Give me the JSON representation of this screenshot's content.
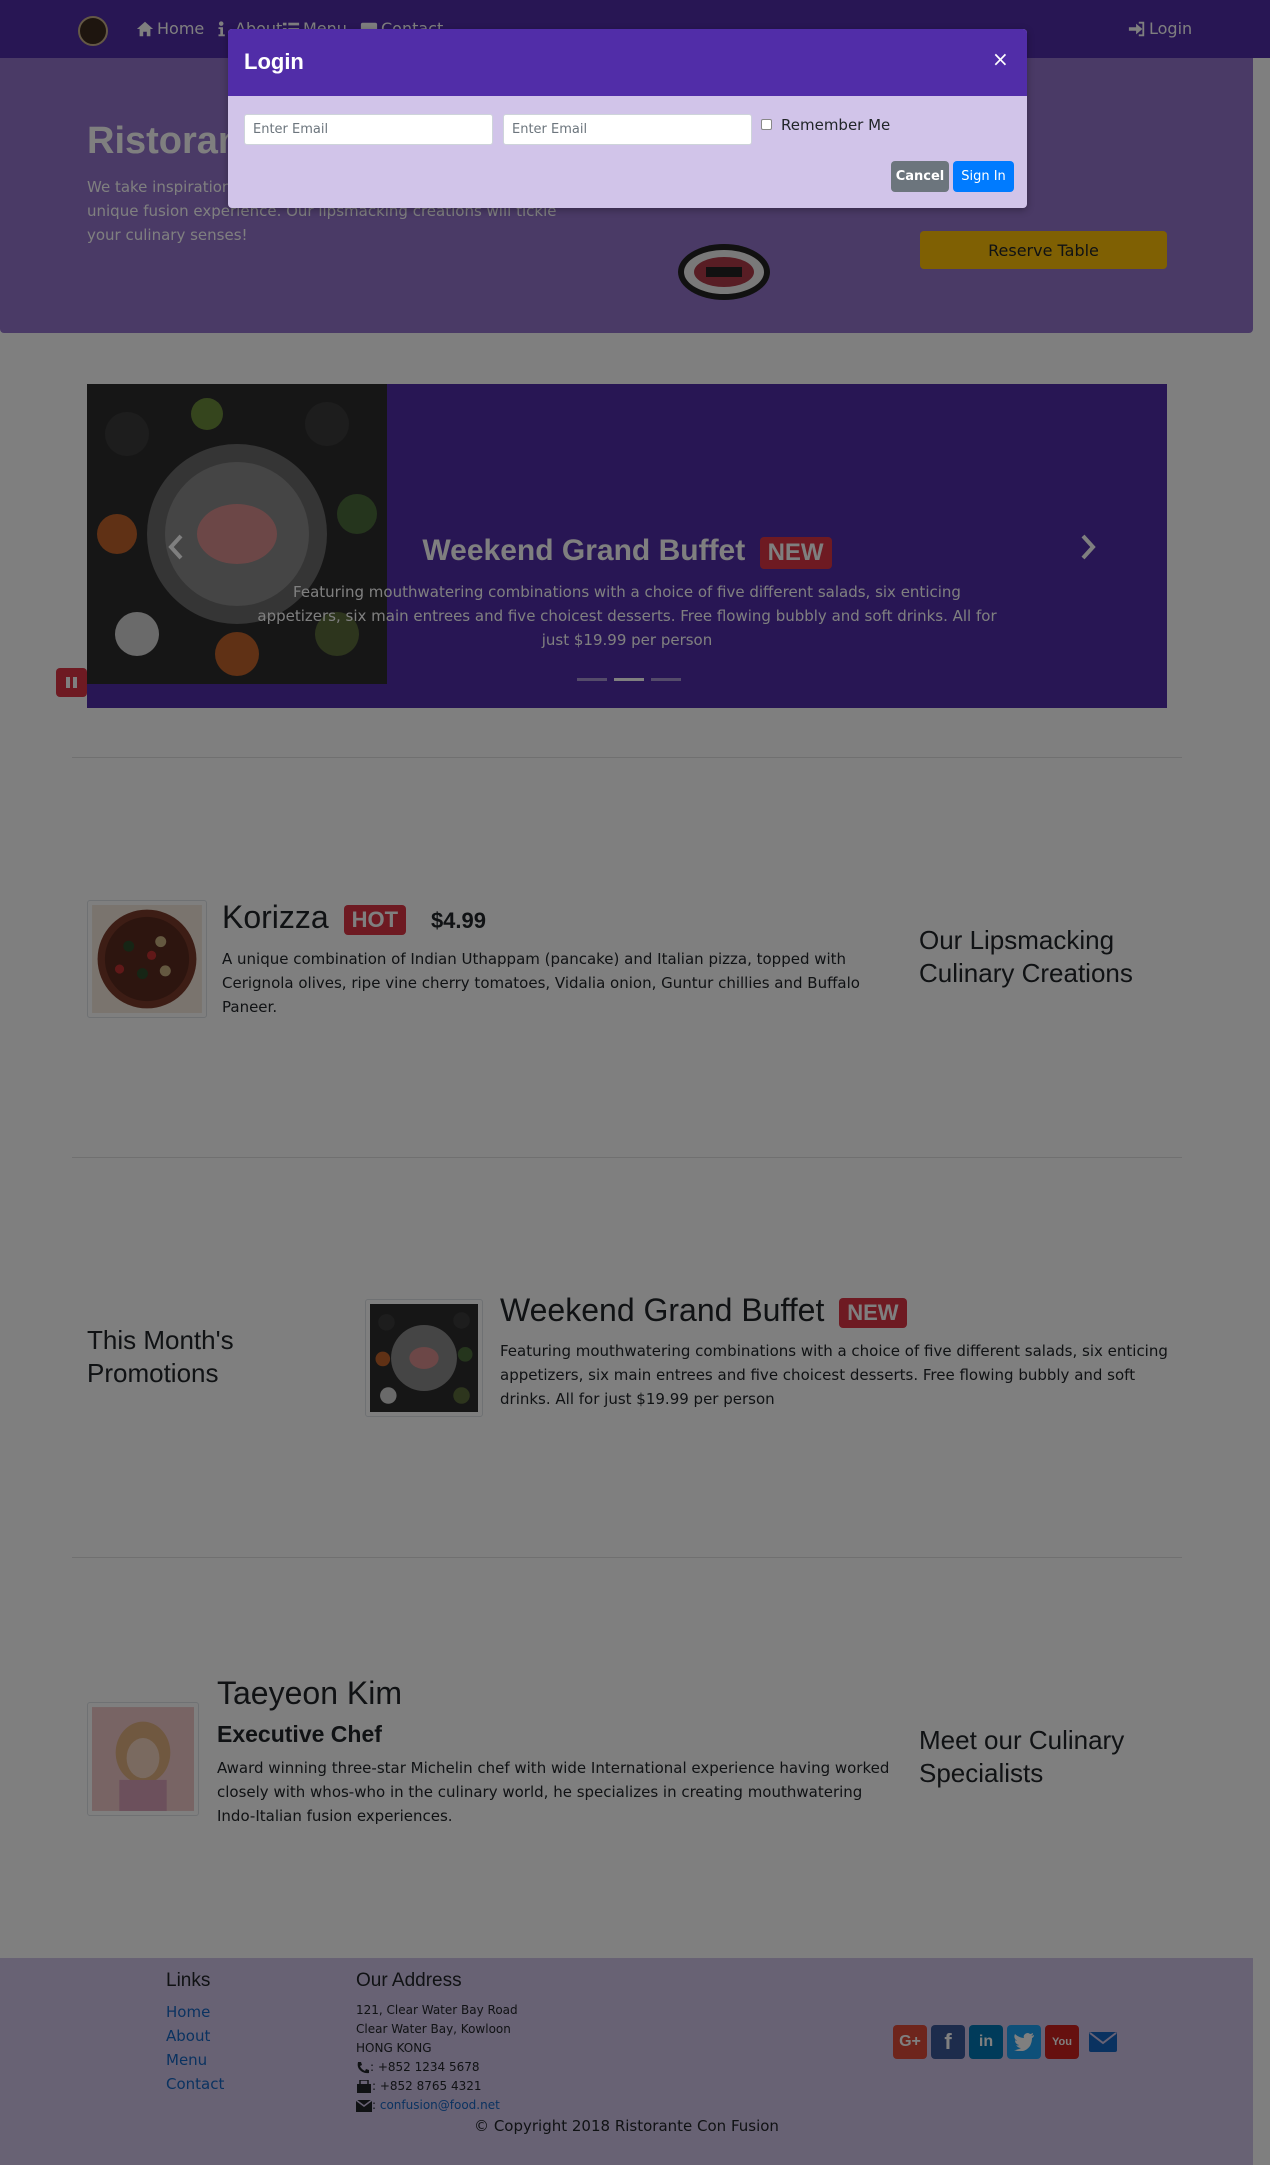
{
  "nav": {
    "items": [
      {
        "label": "Home",
        "icon": "home-icon"
      },
      {
        "label": "About",
        "icon": "info-icon"
      },
      {
        "label": "Menu",
        "icon": "list-icon"
      },
      {
        "label": "Contact",
        "icon": "address-card-icon"
      }
    ],
    "login_label": "Login"
  },
  "jumbotron": {
    "title": "Ristorante Con Fusion",
    "text": "We take inspiration from the World's best cuisines, and create a unique fusion experience. Our lipsmacking creations will tickle your culinary senses!",
    "reserve_label": "Reserve Table"
  },
  "carousel": {
    "title": "Weekend Grand Buffet",
    "badge": "NEW",
    "caption": "Featuring mouthwatering combinations with a choice of five different salads, six enticing appetizers, six main entrees and five choicest desserts. Free flowing bubbly and soft drinks. All for just $19.99 per person",
    "active_slide": 2,
    "slide_count": 3
  },
  "dish": {
    "name": "Korizza",
    "badge": "HOT",
    "price": "$4.99",
    "description": "A unique combination of Indian Uthappam (pancake) and Italian pizza, topped with Cerignola olives, ripe vine cherry tomatoes, Vidalia onion, Guntur chillies and Buffalo Paneer.",
    "side_heading": "Our Lipsmacking Culinary Creations"
  },
  "promotion": {
    "side_heading": "This Month's Promotions",
    "name": "Weekend Grand Buffet",
    "badge": "NEW",
    "description": "Featuring mouthwatering combinations with a choice of five different salads, six enticing appetizers, six main entrees and five choicest desserts. Free flowing bubbly and soft drinks. All for just $19.99 per person"
  },
  "leader": {
    "name": "Taeyeon Kim",
    "designation": "Executive Chef",
    "description": "Award winning three-star Michelin chef with wide International experience having worked closely with whos-who in the culinary world, he specializes in creating mouthwatering Indo-Italian fusion experiences.",
    "side_heading": "Meet our Culinary Specialists"
  },
  "footer": {
    "links_heading": "Links",
    "links": [
      "Home",
      "About",
      "Menu",
      "Contact"
    ],
    "address_heading": "Our Address",
    "address_lines": [
      "121, Clear Water Bay Road",
      "Clear Water Bay, Kowloon",
      "HONG KONG"
    ],
    "phone": ": +852 1234 5678",
    "fax": ": +852 8765 4321",
    "email": "confusion@food.net",
    "social": [
      "google-plus-icon",
      "facebook-icon",
      "linkedin-icon",
      "twitter-icon",
      "youtube-icon",
      "envelope-icon"
    ],
    "copyright": "© Copyright 2018 Ristorante Con Fusion"
  },
  "login_modal": {
    "title": "Login",
    "close": "×",
    "email_placeholder": "Enter Email",
    "password_placeholder": "Enter Email",
    "remember_label": "Remember Me",
    "cancel_label": "Cancel",
    "signin_label": "Sign In"
  },
  "colors": {
    "primary": "#512da8",
    "light": "#9575cd",
    "lighter": "#d1c4e9",
    "danger": "#dc3545",
    "warning": "#ffc107",
    "signin": "#007bff",
    "cancel": "#6c757d"
  }
}
